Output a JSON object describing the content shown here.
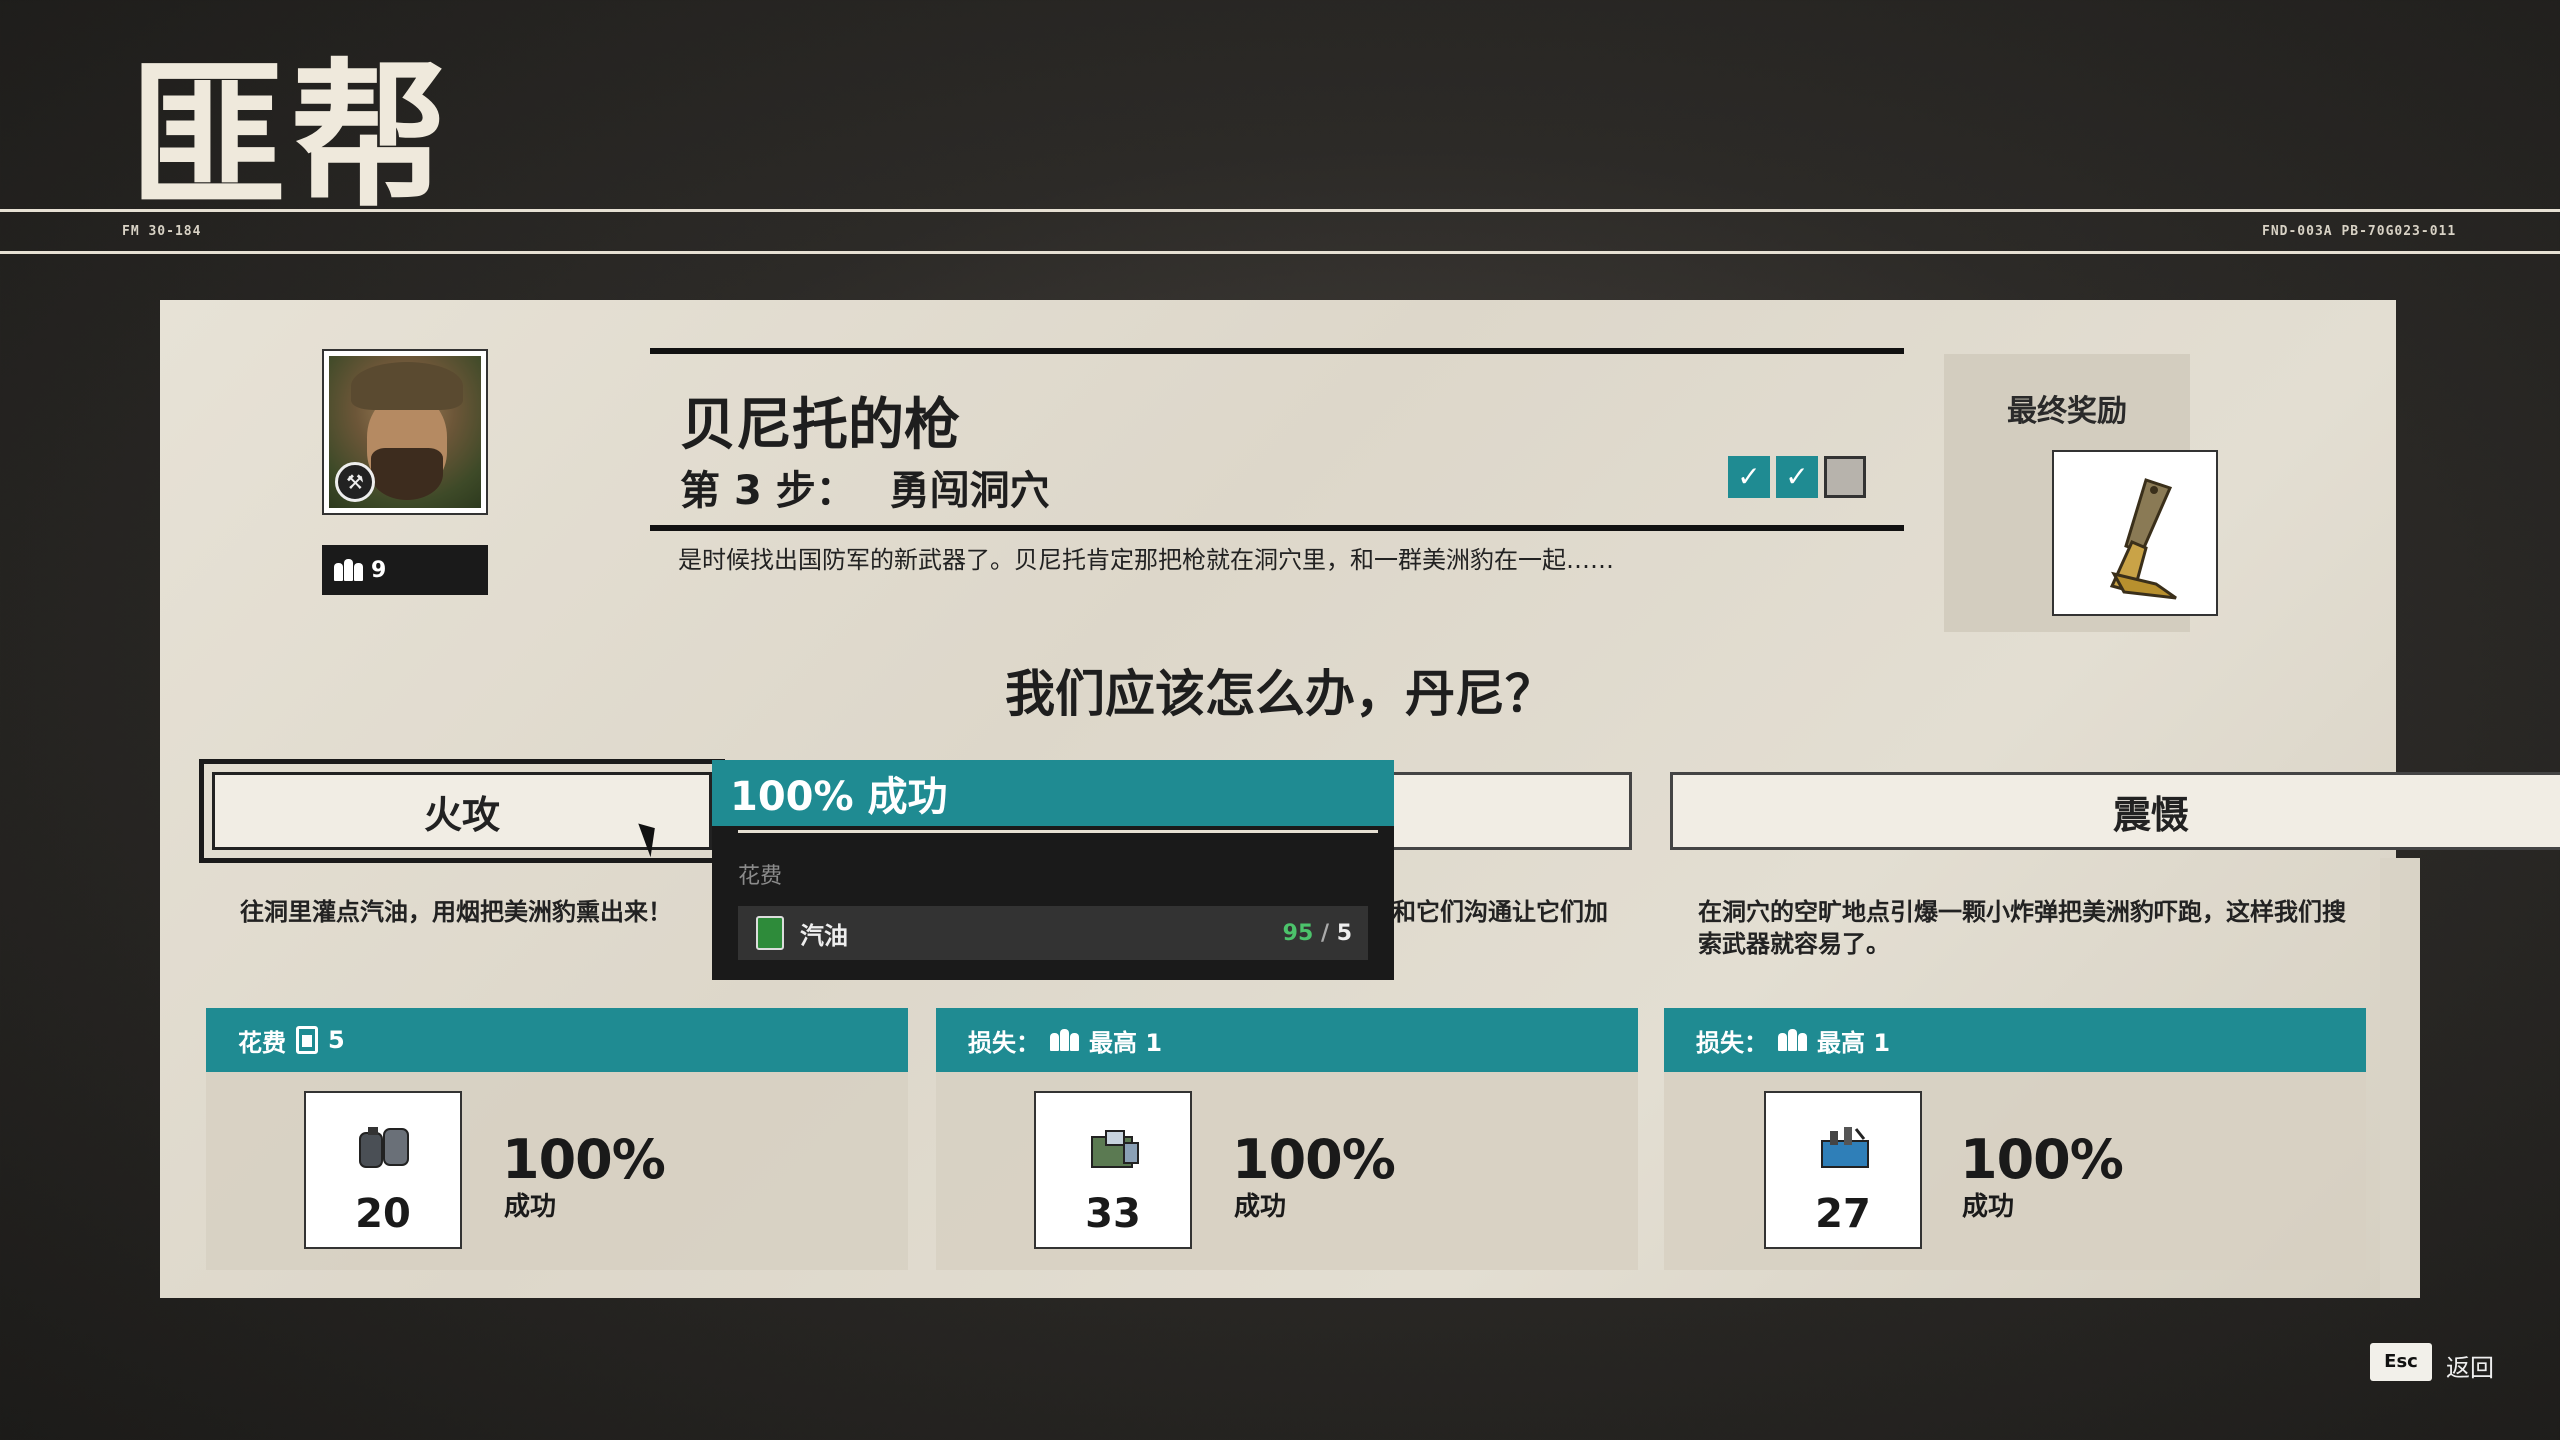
{
  "header": {
    "title": "匪帮",
    "code_left": "FM 30-184",
    "code_right": "FND-003A PB-70G023-011"
  },
  "character": {
    "member_count": "9",
    "portrait_icon": "bandit-portrait"
  },
  "mission": {
    "name": "贝尼托的枪",
    "step_prefix": "第",
    "step_number": "3",
    "step_suffix": "步：",
    "step_name": "勇闯洞穴",
    "progress": {
      "completed": 2,
      "total": 3
    },
    "description": "是时候找出国防军的新武器了。贝尼托肯定那把枪就在洞穴里，和一群美洲豹在一起……"
  },
  "reward": {
    "title": "最终奖励",
    "icon": "golden-pistol-icon"
  },
  "question": "我们应该怎么办，丹尼？",
  "options": [
    {
      "label": "火攻",
      "description": "往洞里灌点汽油，用烟把美洲豹熏出来！",
      "bar_prefix": "花费",
      "bar_value": "5",
      "bar_icon": "fuel-icon",
      "resource_count": "20",
      "resource_icon": "canister-icon",
      "success_pct": "100%",
      "success_label": "成功",
      "selected": true
    },
    {
      "label": "",
      "description": "和它们沟通让它们加",
      "bar_prefix": "损失：",
      "bar_value": "最高 1",
      "bar_icon": "people-icon",
      "resource_count": "33",
      "resource_icon": "supply-crate-icon",
      "success_pct": "100%",
      "success_label": "成功",
      "selected": false
    },
    {
      "label": "震慑",
      "description": "在洞穴的空旷地点引爆一颗小炸弹把美洲豹吓跑，这样我们搜索武器就容易了。",
      "bar_prefix": "损失：",
      "bar_value": "最高 1",
      "bar_icon": "people-icon",
      "resource_count": "27",
      "resource_icon": "explosive-box-icon",
      "success_pct": "100%",
      "success_label": "成功",
      "selected": false
    }
  ],
  "tooltip": {
    "title": "100% 成功",
    "cost_label": "花费",
    "item_name": "汽油",
    "item_have": "95",
    "item_sep": "/",
    "item_need": "5"
  },
  "footer": {
    "esc_key": "Esc",
    "esc_label": "返回"
  },
  "colors": {
    "accent": "#1f8b92",
    "paper": "#e3ded2",
    "have_green": "#4cc36b"
  }
}
